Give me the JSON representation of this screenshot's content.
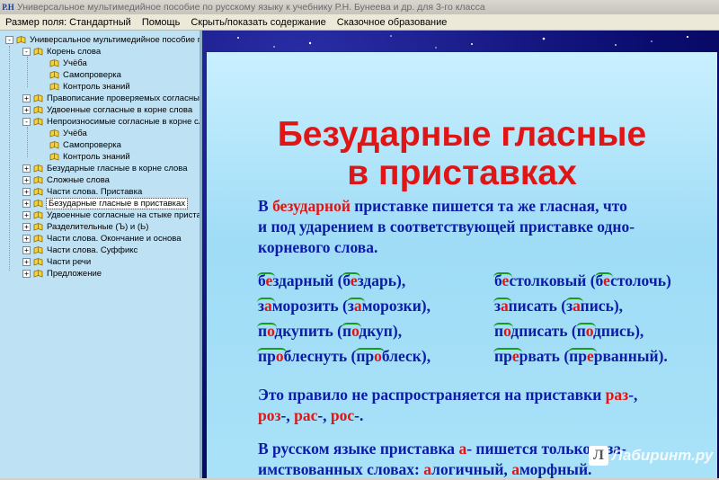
{
  "window": {
    "title": "Универсальное мультимедийное пособие по русскому языку к учебнику Р.Н. Бунеева и др. для 3-го класса",
    "icon_label": "Р.Н"
  },
  "menu": [
    "Размер поля: Стандартный",
    "Помощь",
    "Скрыть/показать содержание",
    "Сказочное образование"
  ],
  "tree": [
    {
      "label": "Универсальное мультимедийное пособие по",
      "level": 0,
      "expander": "-"
    },
    {
      "label": "Корень слова",
      "level": 1,
      "expander": "-"
    },
    {
      "label": "Учёба",
      "level": 2,
      "expander": ""
    },
    {
      "label": "Самопроверка",
      "level": 2,
      "expander": ""
    },
    {
      "label": "Контроль знаний",
      "level": 2,
      "expander": ""
    },
    {
      "label": "Правописание проверяемых согласных в",
      "level": 1,
      "expander": "+"
    },
    {
      "label": "Удвоенные согласные в корне слова",
      "level": 1,
      "expander": "+"
    },
    {
      "label": "Непроизносимые согласные в корне сло",
      "level": 1,
      "expander": "-"
    },
    {
      "label": "Учёба",
      "level": 2,
      "expander": ""
    },
    {
      "label": "Самопроверка",
      "level": 2,
      "expander": ""
    },
    {
      "label": "Контроль знаний",
      "level": 2,
      "expander": ""
    },
    {
      "label": "Безударные гласные в корне слова",
      "level": 1,
      "expander": "+"
    },
    {
      "label": "Сложные слова",
      "level": 1,
      "expander": "+"
    },
    {
      "label": "Части слова. Приставка",
      "level": 1,
      "expander": "+"
    },
    {
      "label": "Безударные гласные в приставках",
      "level": 1,
      "expander": "+",
      "selected": true
    },
    {
      "label": "Удвоенные согласные на стыке приставк",
      "level": 1,
      "expander": "+"
    },
    {
      "label": "Разделительные (Ъ) и (Ь)",
      "level": 1,
      "expander": "+"
    },
    {
      "label": "Части слова. Окончание и основа",
      "level": 1,
      "expander": "+"
    },
    {
      "label": "Части слова. Суффикс",
      "level": 1,
      "expander": "+"
    },
    {
      "label": "Части речи",
      "level": 1,
      "expander": "+"
    },
    {
      "label": "Предложение",
      "level": 1,
      "expander": "+"
    }
  ],
  "slide": {
    "title_line1": "Безударные гласные",
    "title_line2": "в приставках",
    "rule": {
      "l1a": "В ",
      "l1r": "безударной",
      "l1b": " приставке пишется та же гласная, что",
      "l2": "и под ударением в соответствующей приставке одно-",
      "l3": "корневого слова."
    },
    "examples": [
      {
        "col": 0,
        "row": 0,
        "a": "б",
        "r": "е",
        "b": "здарный (б",
        "r2": "е",
        "c": "здарь),"
      },
      {
        "col": 0,
        "row": 1,
        "a": "з",
        "r": "а",
        "b": "морозить (з",
        "r2": "а",
        "c": "морозки),"
      },
      {
        "col": 0,
        "row": 2,
        "a": "п",
        "r": "о",
        "b": "дкупить (п",
        "r2": "о",
        "c": "дкуп),"
      },
      {
        "col": 0,
        "row": 3,
        "a": "пр",
        "r": "о",
        "b": "блеснуть (пр",
        "r2": "о",
        "c": "блеск),"
      },
      {
        "col": 1,
        "row": 0,
        "a": "б",
        "r": "е",
        "b": "столковый (б",
        "r2": "е",
        "c": "столочь)"
      },
      {
        "col": 1,
        "row": 1,
        "a": "з",
        "r": "а",
        "b": "писать (з",
        "r2": "а",
        "c": "пись),"
      },
      {
        "col": 1,
        "row": 2,
        "a": "п",
        "r": "о",
        "b": "дписать (п",
        "r2": "о",
        "c": "дпись),"
      },
      {
        "col": 1,
        "row": 3,
        "a": "пр",
        "r": "е",
        "b": "рвать (пр",
        "r2": "е",
        "c": "рванный)."
      }
    ],
    "exception": {
      "l1a": "Это правило не распространяется на приставки ",
      "l1r": "раз",
      "l1b": "-,",
      "l2r1": "роз",
      "l2a": "-, ",
      "l2r2": "рас",
      "l2b": "-, ",
      "l2r3": "рос",
      "l2c": "-."
    },
    "borrowed": {
      "l1a": "В русском языке приставка ",
      "l1r": "а",
      "l1b": "- пишется только в за-",
      "l2a": "имствованных словах: ",
      "l2r1": "а",
      "l2b": "логичный, ",
      "l2r2": "а",
      "l2c": "морфный."
    }
  },
  "watermark": {
    "badge": "Л",
    "text": "Лабиринт.ру"
  },
  "colors": {
    "accent_red": "#e01515",
    "text_blue": "#0c1ca8",
    "arc_green": "#1a9b1a",
    "tree_bg": "#bfe1f4"
  }
}
